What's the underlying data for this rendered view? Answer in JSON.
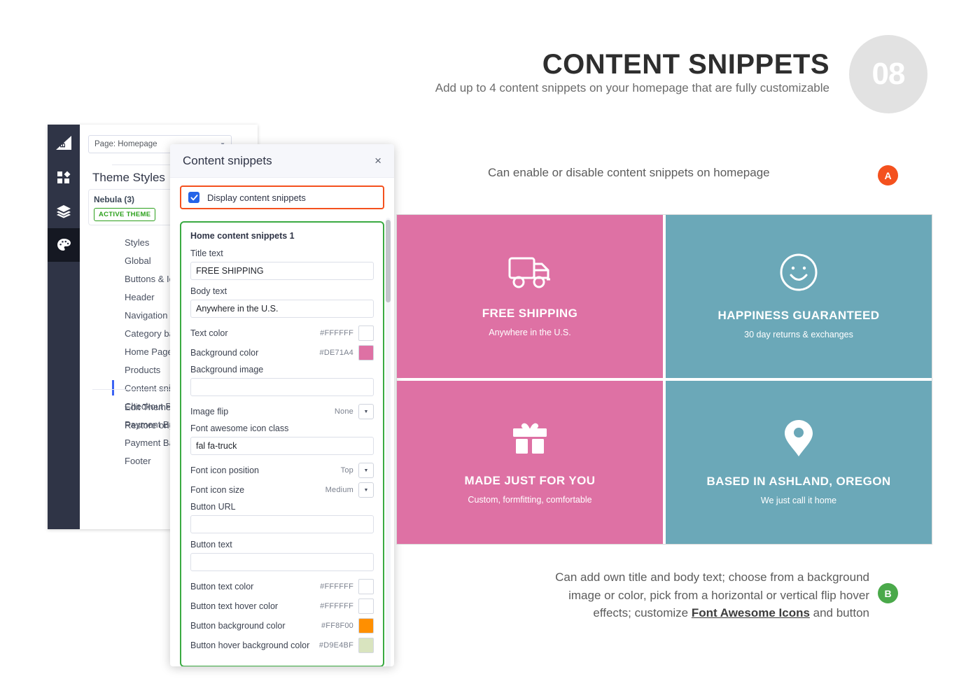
{
  "header": {
    "title": "CONTENT SNIPPETS",
    "subtitle": "Add up to 4 content snippets on your homepage that are fully customizable",
    "step_number": "08"
  },
  "app": {
    "rail_icons": [
      "bigcommerce-logo-icon",
      "apps-grid-icon",
      "layers-icon",
      "palette-icon"
    ],
    "page_select": {
      "value": "Page: Homepage",
      "caret": "▼"
    },
    "panel_title": "Theme Styles",
    "theme": {
      "name": "Nebula (3)",
      "badge": "ACTIVE THEME"
    },
    "nav_items": [
      "Styles",
      "Global",
      "Buttons & Icons",
      "Header",
      "Navigation",
      "Category banners",
      "Home Page",
      "Products",
      "Content snippets",
      "Checkout Page",
      "Payment Buttons",
      "Payment Banners",
      "Footer"
    ],
    "nav_active": "Content snippets",
    "nav_extra": [
      "Edit Theme Files",
      "Restore original theme"
    ]
  },
  "dialog": {
    "title": "Content snippets",
    "close_glyph": "×",
    "display_checkbox": {
      "label": "Display content snippets",
      "checked": true
    },
    "group_title": "Home content snippets 1",
    "fields": {
      "title_text": {
        "label": "Title text",
        "value": "FREE SHIPPING"
      },
      "body_text": {
        "label": "Body text",
        "value": "Anywhere in the U.S."
      },
      "text_color": {
        "label": "Text color",
        "value": "#FFFFFF",
        "swatch": "#FFFFFF"
      },
      "background_color": {
        "label": "Background color",
        "value": "#DE71A4",
        "swatch": "#DE71A4"
      },
      "background_image": {
        "label": "Background image",
        "value": ""
      },
      "image_flip": {
        "label": "Image flip",
        "value": "None"
      },
      "font_awesome_icon_class": {
        "label": "Font awesome icon class",
        "value": "fal fa-truck"
      },
      "font_icon_position": {
        "label": "Font icon position",
        "value": "Top"
      },
      "font_icon_size": {
        "label": "Font icon size",
        "value": "Medium"
      },
      "button_url": {
        "label": "Button URL",
        "value": ""
      },
      "button_text": {
        "label": "Button text",
        "value": ""
      },
      "button_text_color": {
        "label": "Button text color",
        "value": "#FFFFFF",
        "swatch": "#FFFFFF"
      },
      "button_text_hover_color": {
        "label": "Button text hover color",
        "value": "#FFFFFF",
        "swatch": "#FFFFFF"
      },
      "button_background_color": {
        "label": "Button background color",
        "value": "#FF8F00",
        "swatch": "#FF8F00"
      },
      "button_hover_background_color": {
        "label": "Button hover background color",
        "value": "#D9E4BF",
        "swatch": "#D9E4BF"
      }
    }
  },
  "snippet_cards": [
    {
      "icon": "truck-icon",
      "title": "FREE SHIPPING",
      "body": "Anywhere in the U.S.",
      "bg": "#DE71A4"
    },
    {
      "icon": "smiley-face-icon",
      "title": "HAPPINESS GUARANTEED",
      "body": "30 day returns & exchanges",
      "bg": "#6BA8B8"
    },
    {
      "icon": "gift-icon",
      "title": "MADE JUST FOR YOU",
      "body": "Custom, formfitting, comfortable",
      "bg": "#DE71A4"
    },
    {
      "icon": "map-pin-icon",
      "title": "BASED IN ASHLAND, OREGON",
      "body": "We just call it home",
      "bg": "#6BA8B8"
    }
  ],
  "callouts": {
    "a": {
      "badge": "A",
      "text": "Can enable or disable content snippets on homepage",
      "color": "#F4511E"
    },
    "b": {
      "badge": "B",
      "line1": "Can add own title and body text; choose from a background",
      "line2": "image or color, pick from a horizontal or vertical flip hover",
      "line3_pre": "effects; customize ",
      "line3_link": "Font Awesome Icons",
      "line3_post": " and button",
      "color": "#4AA94A"
    }
  }
}
